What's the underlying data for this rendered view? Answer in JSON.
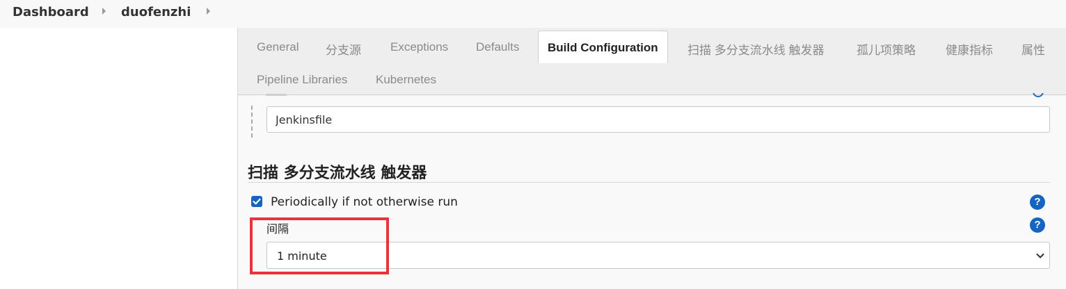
{
  "breadcrumb": {
    "home": "Dashboard",
    "job": "duofenzhi",
    "separator_icon": "caret-right-icon"
  },
  "tabs": [
    {
      "label": "General",
      "active": false
    },
    {
      "label": "分支源",
      "active": false
    },
    {
      "label": "Exceptions",
      "active": false
    },
    {
      "label": "Defaults",
      "active": false
    },
    {
      "label": "Build Configuration",
      "active": true
    },
    {
      "label": "扫描 多分支流水线 触发器",
      "active": false
    },
    {
      "label": "孤儿项策略",
      "active": false
    },
    {
      "label": "健康指标",
      "active": false
    },
    {
      "label": "属性",
      "active": false
    },
    {
      "label": "Pipeline Libraries",
      "active": false
    },
    {
      "label": "Kubernetes",
      "active": false
    }
  ],
  "build_config": {
    "script_path_value": "Jenkinsfile"
  },
  "scan_triggers": {
    "section_title": "扫描 多分支流水线 触发器",
    "periodic_label": "Periodically if not otherwise run",
    "periodic_checked": true,
    "interval_label": "间隔",
    "interval_value": "1 minute",
    "help_symbol": "?"
  },
  "colors": {
    "accent": "#1565c0",
    "highlight": "#e8333a",
    "tabbar_bg": "#eeeeee",
    "panel_bg": "#f9f9f9"
  }
}
